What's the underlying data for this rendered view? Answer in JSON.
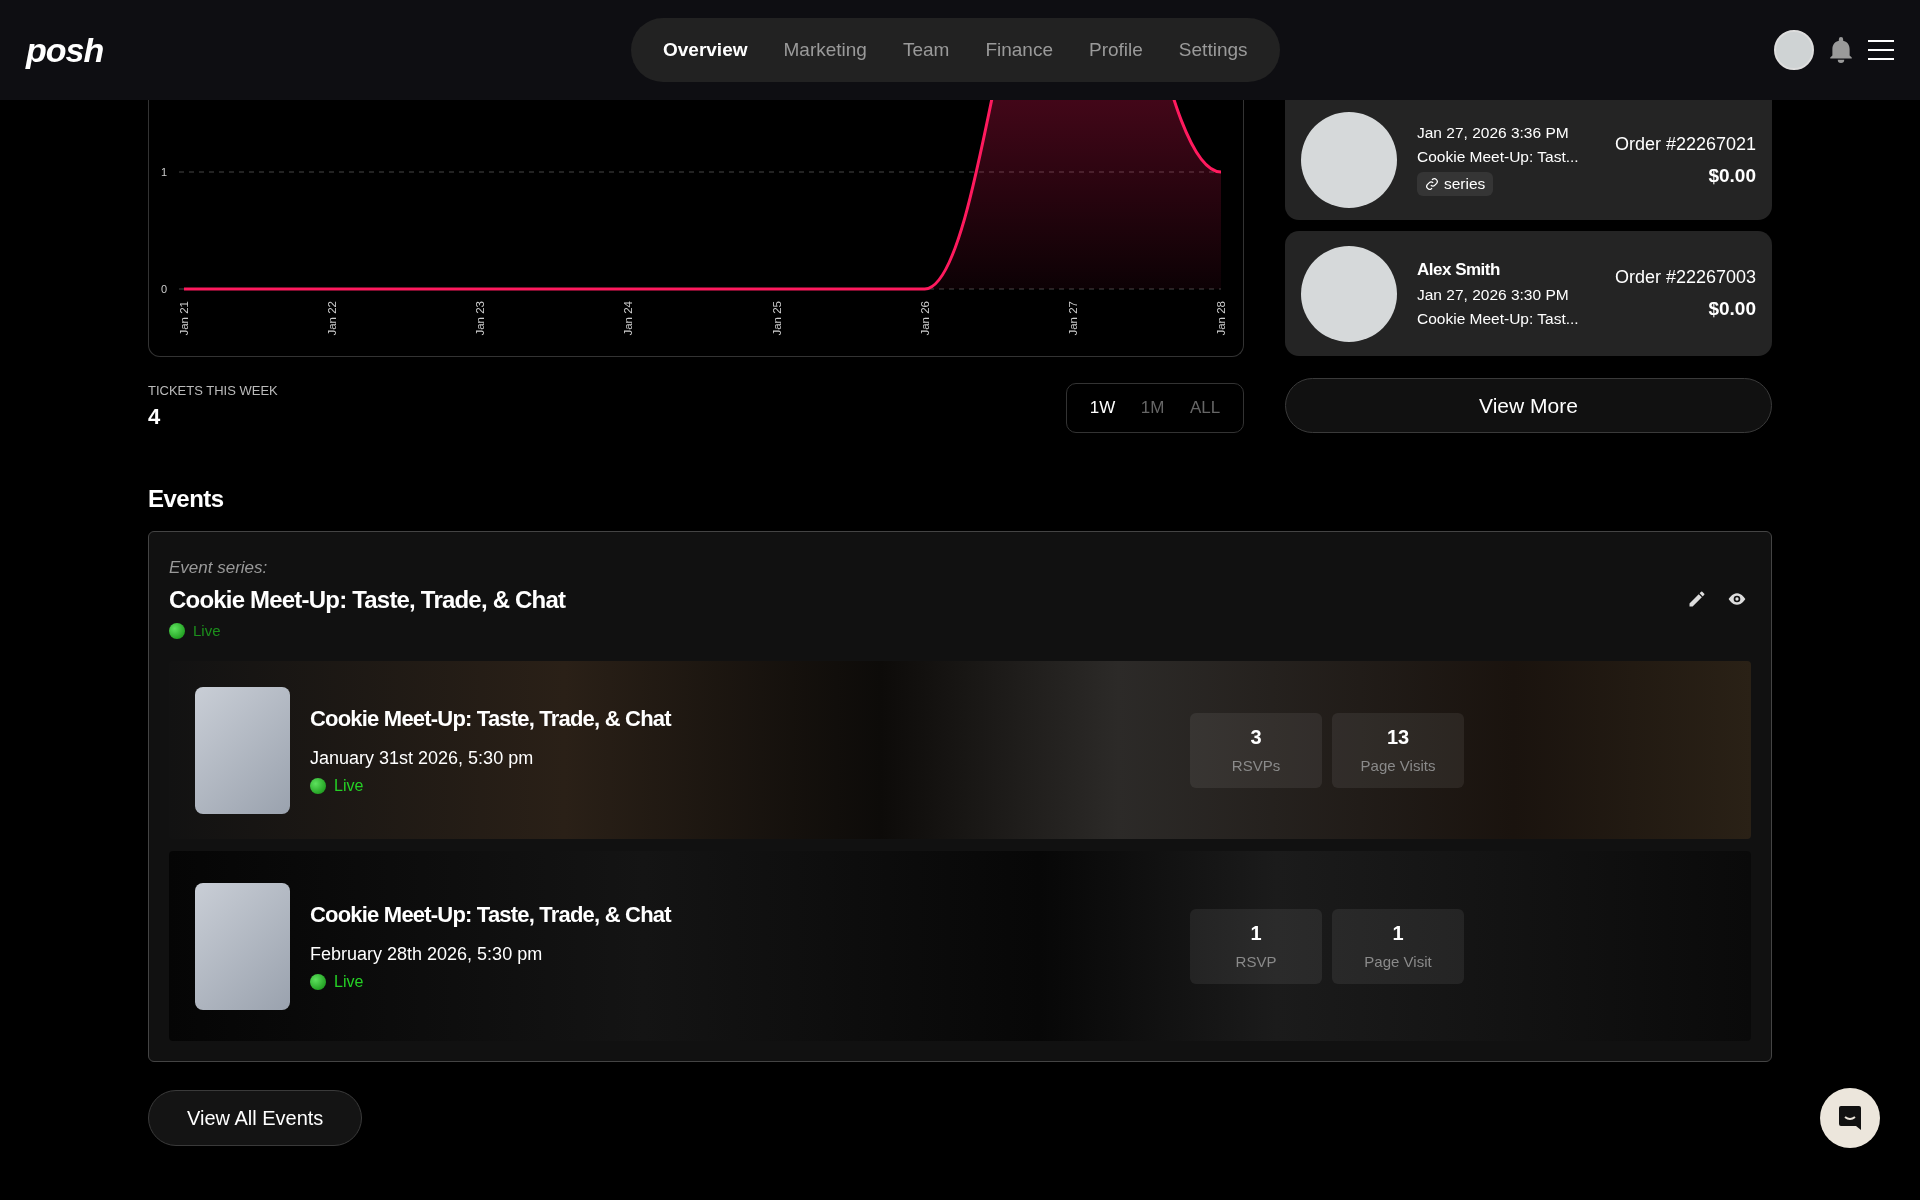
{
  "nav": {
    "logo": "posh",
    "tabs": [
      {
        "label": "Overview",
        "selected": true
      },
      {
        "label": "Marketing",
        "selected": false
      },
      {
        "label": "Team",
        "selected": false
      },
      {
        "label": "Finance",
        "selected": false
      },
      {
        "label": "Profile",
        "selected": false
      },
      {
        "label": "Settings",
        "selected": false
      }
    ]
  },
  "sales_chart": {
    "chart_data": {
      "type": "area",
      "x": [
        "Jan 21",
        "Jan 22",
        "Jan 23",
        "Jan 24",
        "Jan 25",
        "Jan 26",
        "Jan 27",
        "Jan 28"
      ],
      "series": [
        {
          "color": "#ff1a5e",
          "values": [
            0,
            0,
            0,
            0,
            0,
            0,
            null,
            1
          ]
        }
      ],
      "ylim": [
        0,
        1
      ],
      "yticks": [
        0,
        1
      ]
    }
  },
  "tickets_this_week": {
    "label": "TICKETS THIS WEEK",
    "value": "4"
  },
  "range_options": [
    {
      "label": "1W",
      "selected": true
    },
    {
      "label": "1M",
      "selected": false
    },
    {
      "label": "ALL",
      "selected": false
    }
  ],
  "orders": [
    {
      "datetime": "Jan 27, 2026 3:36 PM",
      "event": "Cookie Meet-Up: Tast...",
      "tag": "series",
      "order": "Order #22267021",
      "amount": "$0.00"
    },
    {
      "name": "Alex Smith",
      "datetime": "Jan 27, 2026 3:30 PM",
      "event": "Cookie Meet-Up: Tast...",
      "order": "Order #22267003",
      "amount": "$0.00"
    }
  ],
  "view_more": "View More",
  "events": {
    "heading": "Events",
    "series_label": "Event series:",
    "title": "Cookie Meet-Up: Taste, Trade, & Chat",
    "status": "Live",
    "items": [
      {
        "title": "Cookie Meet-Up: Taste, Trade, & Chat",
        "date": "January 31st 2026, 5:30 pm",
        "status": "Live",
        "stats": [
          {
            "value": "3",
            "label": "RSVPs"
          },
          {
            "value": "13",
            "label": "Page Visits"
          }
        ]
      },
      {
        "title": "Cookie Meet-Up: Taste, Trade, & Chat",
        "date": "February 28th 2026, 5:30 pm",
        "status": "Live",
        "stats": [
          {
            "value": "1",
            "label": "RSVP"
          },
          {
            "value": "1",
            "label": "Page Visit"
          }
        ]
      }
    ]
  },
  "view_all": "View All Events"
}
